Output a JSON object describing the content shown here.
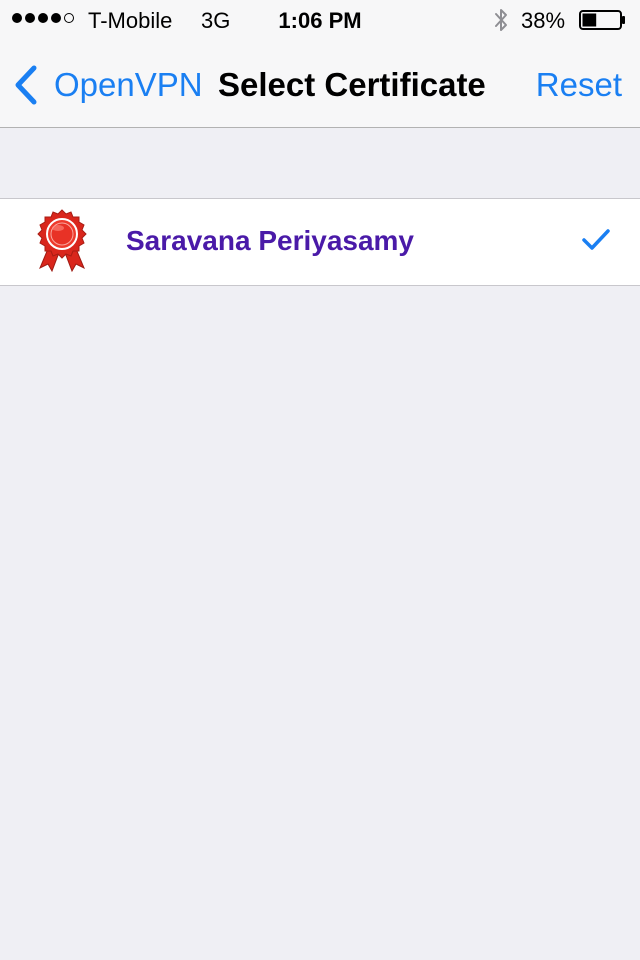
{
  "status_bar": {
    "signal_dots": 5,
    "signal_filled": 4,
    "carrier": "T-Mobile",
    "network": "3G",
    "time": "1:06 PM",
    "bluetooth_icon": "bluetooth-icon",
    "battery_percent": "38%",
    "battery_level": 0.38
  },
  "nav_bar": {
    "back_label": "OpenVPN",
    "title": "Select Certificate",
    "action_label": "Reset"
  },
  "certificates": [
    {
      "name": "Saravana Periyasamy",
      "icon": "certificate-ribbon-icon",
      "selected": true
    }
  ],
  "colors": {
    "tint": "#1a7ff2",
    "cert_name": "#4a1aa8",
    "background": "#efeff4"
  }
}
